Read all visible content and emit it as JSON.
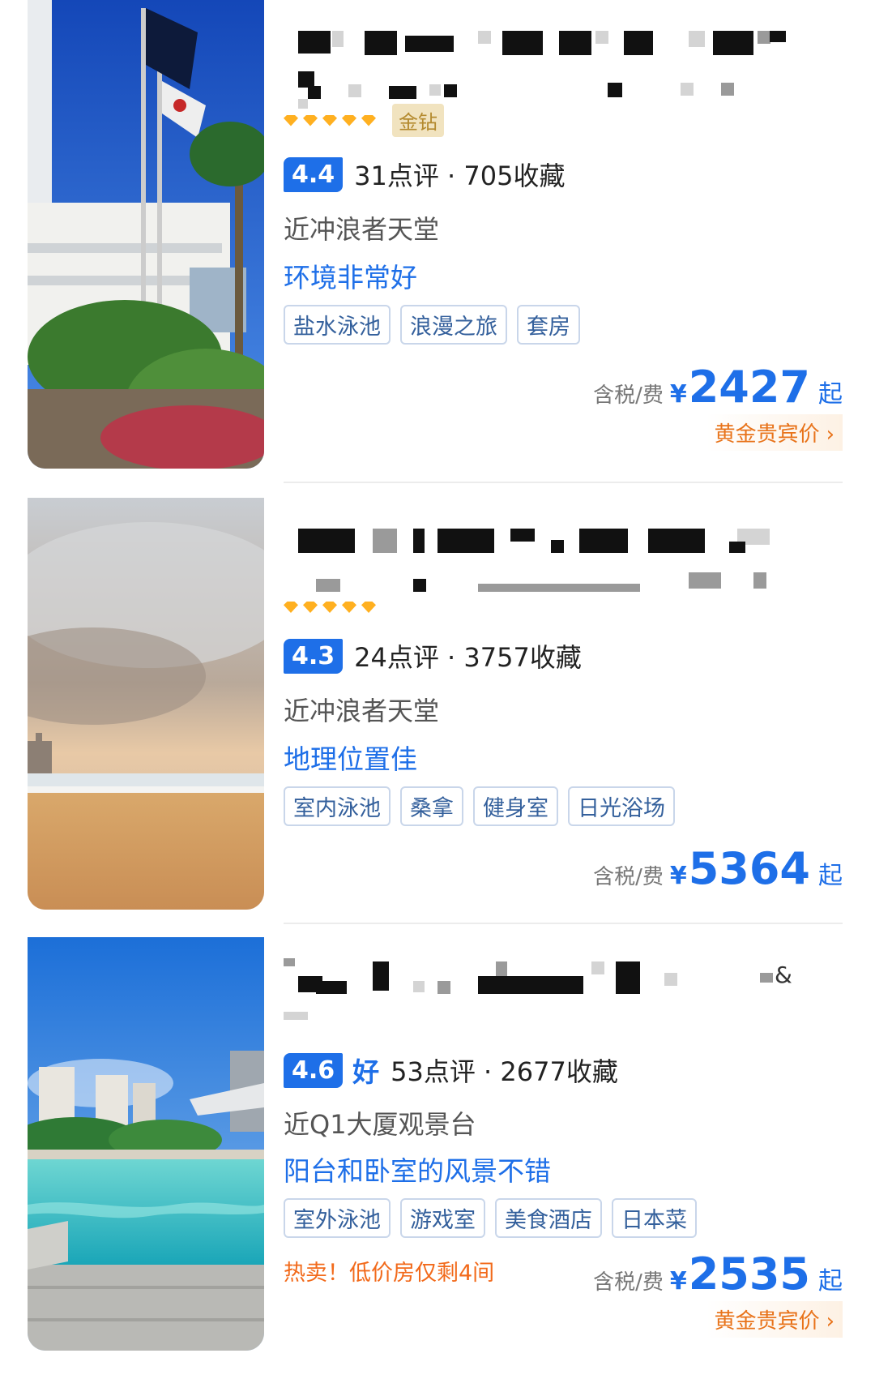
{
  "hotels": [
    {
      "name_blurred": true,
      "gold_badge": "金钻",
      "score": "4.4",
      "score_word": "",
      "reviews": "31点评 · 705收藏",
      "location": "近冲浪者天堂",
      "highlight": "环境非常好",
      "tags": [
        "盐水泳池",
        "浪漫之旅",
        "套房"
      ],
      "tax_label": "含税/费",
      "currency": "¥",
      "price": "2427",
      "from_label": "起",
      "vip_label": "黄金贵宾价",
      "vip_chevron": "›"
    },
    {
      "name_blurred": true,
      "score": "4.3",
      "score_word": "",
      "reviews": "24点评 · 3757收藏",
      "location": "近冲浪者天堂",
      "highlight": "地理位置佳",
      "tags": [
        "室内泳池",
        "桑拿",
        "健身室",
        "日光浴场"
      ],
      "tax_label": "含税/费",
      "currency": "¥",
      "price": "5364",
      "from_label": "起"
    },
    {
      "name_blurred": true,
      "name_suffix": "&",
      "score": "4.6",
      "score_word": "好",
      "reviews": "53点评 · 2677收藏",
      "location": "近Q1大厦观景台",
      "highlight": "阳台和卧室的风景不错",
      "tags": [
        "室外泳池",
        "游戏室",
        "美食酒店",
        "日本菜"
      ],
      "hot_sale": "热卖！低价房仅剩4间",
      "tax_label": "含税/费",
      "currency": "¥",
      "price": "2535",
      "from_label": "起",
      "vip_label": "黄金贵宾价",
      "vip_chevron": "›"
    }
  ],
  "colors": {
    "accent": "#1e6fe8",
    "tag_text": "#34609c",
    "hot": "#f26a1b",
    "vip": "#e8731a",
    "gold_badge_bg": "#f1e3bf"
  }
}
